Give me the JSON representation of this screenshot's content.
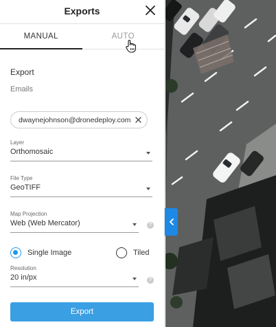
{
  "panel": {
    "title": "Exports",
    "tabs": [
      {
        "label": "MANUAL",
        "active": true
      },
      {
        "label": "AUTO",
        "active": false
      }
    ],
    "section_title": "Export",
    "emails_label": "Emails",
    "email_chip": "dwaynejohnson@dronedeploy.com",
    "layer": {
      "label": "Layer",
      "value": "Orthomosaic"
    },
    "file_type": {
      "label": "File Type",
      "value": "GeoTIFF"
    },
    "projection": {
      "label": "Map Projection",
      "value": "Web (Web Mercator)"
    },
    "radio_options": [
      {
        "label": "Single Image",
        "selected": true
      },
      {
        "label": "Tiled",
        "selected": false
      }
    ],
    "resolution": {
      "label": "Resolution",
      "value": "20 in/px"
    },
    "export_button": "Export",
    "help_glyph": "?"
  },
  "colors": {
    "accent": "#3a9fe3",
    "collapse_tab": "#1e88e5"
  },
  "icons": {
    "close": "close-icon",
    "cursor": "hand-pointer-icon",
    "chip_remove": "close-icon",
    "collapse": "chevron-left-icon",
    "help": "help-icon"
  }
}
